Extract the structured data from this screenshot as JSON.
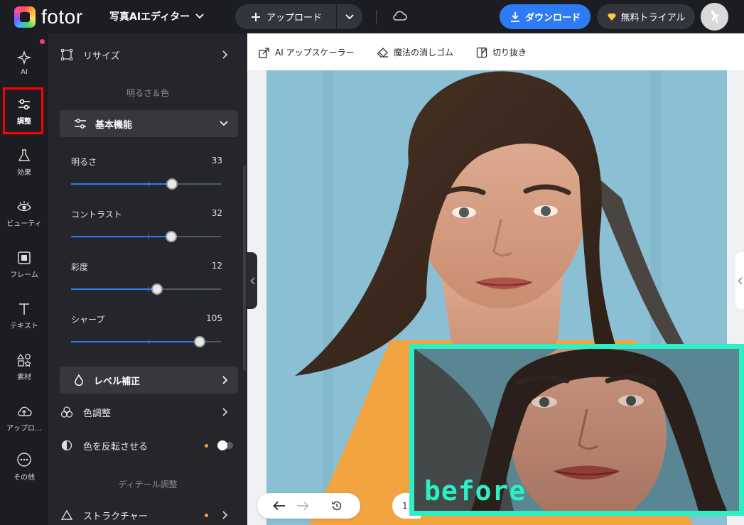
{
  "header": {
    "logo_text": "fotor",
    "editor_name": "写真AIエディター",
    "upload_label": "アップロード",
    "download_label": "ダウンロード",
    "trial_label": "無料トライアル"
  },
  "rail": {
    "items": [
      {
        "label": "AI",
        "icon": "sparkle-icon"
      },
      {
        "label": "調整",
        "icon": "sliders-icon"
      },
      {
        "label": "効果",
        "icon": "flask-icon"
      },
      {
        "label": "ビューティ",
        "icon": "eye-icon"
      },
      {
        "label": "フレーム",
        "icon": "frame-icon"
      },
      {
        "label": "テキスト",
        "icon": "text-icon"
      },
      {
        "label": "素材",
        "icon": "shapes-icon"
      },
      {
        "label": "アップロ…",
        "icon": "cloud-upload-icon"
      },
      {
        "label": "その他",
        "icon": "more-icon"
      }
    ]
  },
  "panel": {
    "resize_label": "リサイズ",
    "brightness_section": "明るさ＆色",
    "basic_label": "基本機能",
    "sliders": [
      {
        "label": "明るさ",
        "value": "33",
        "fraction": 0.673
      },
      {
        "label": "コントラスト",
        "value": "32",
        "fraction": 0.668
      },
      {
        "label": "彩度",
        "value": "12",
        "fraction": 0.573
      },
      {
        "label": "シャープ",
        "value": "105",
        "fraction": 0.856
      }
    ],
    "level_label": "レベル補正",
    "color_adjust_label": "色調整",
    "invert_label": "色を反転させる",
    "detail_section": "ディテール調整",
    "structure_label": "ストラクチャー"
  },
  "tools": {
    "upscaler_label": "AI アップスケーラー",
    "eraser_label": "魔法の消しゴム",
    "crop_label": "切り抜き"
  },
  "canvas": {
    "zoom_text": "1",
    "before_label": "before"
  },
  "colors": {
    "accent": "#2f7bf5",
    "before_border": "#2cf0c3",
    "highlight": "#ff0000",
    "photo_top": "#f0a340"
  }
}
